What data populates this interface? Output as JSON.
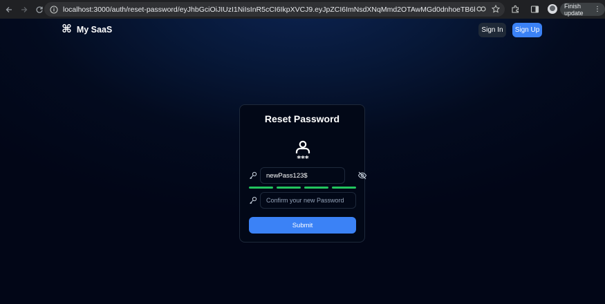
{
  "browser": {
    "url": "localhost:3000/auth/reset-password/eyJhbGciOiJIUzI1NiIsInR5cCI6IkpXVCJ9.eyJpZCI6ImNsdXNqMmd2OTAwMGd0dnhoeTB6bnZibXliLCJpYXQiOjE3MTMzMTcwMzh9.JdF...",
    "finish_update_label": "Finish update"
  },
  "header": {
    "brand": "My SaaS",
    "sign_in_label": "Sign In",
    "sign_up_label": "Sign Up"
  },
  "form": {
    "title": "Reset Password",
    "password_value": "newPass123$",
    "confirm_placeholder": "Confirm your new Password",
    "submit_label": "Submit",
    "strength_segments": 4
  },
  "colors": {
    "accent": "#3b82f6",
    "strength": "#22c55e",
    "card_bg": "#020817"
  }
}
